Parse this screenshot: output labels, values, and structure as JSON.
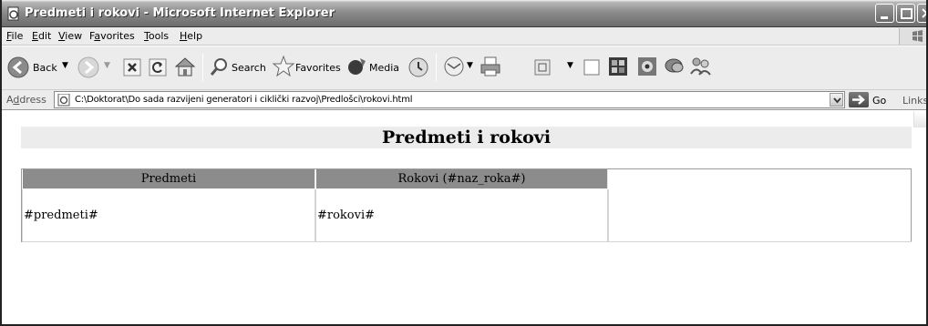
{
  "window": {
    "title": "Predmeti i rokovi - Microsoft Internet Explorer"
  },
  "menu": {
    "items": [
      {
        "first": "F",
        "rest": "ile"
      },
      {
        "first": "E",
        "rest": "dit"
      },
      {
        "first": "V",
        "rest": "iew"
      },
      {
        "pre": "F",
        "first": "a",
        "rest": "vorites"
      },
      {
        "first": "T",
        "rest": "ools"
      },
      {
        "first": "H",
        "rest": "elp"
      }
    ]
  },
  "toolbar": {
    "back_label": "Back",
    "search_label": "Search",
    "favorites_label": "Favorites",
    "media_label": "Media"
  },
  "address": {
    "label_first": "d",
    "label_pre": "A",
    "label_rest": "dress",
    "value": "C:\\Doktorat\\Do sada razvijeni generatori i ciklički razvoj\\Predlošci\\rokovi.html",
    "go_label": "Go",
    "links_label": "Links"
  },
  "page": {
    "title": "Predmeti i rokovi",
    "table": {
      "headers": [
        "Predmeti",
        "Rokovi (#naz_roka#)"
      ],
      "cells": [
        "#predmeti#",
        "#rokovi#",
        ""
      ]
    }
  }
}
